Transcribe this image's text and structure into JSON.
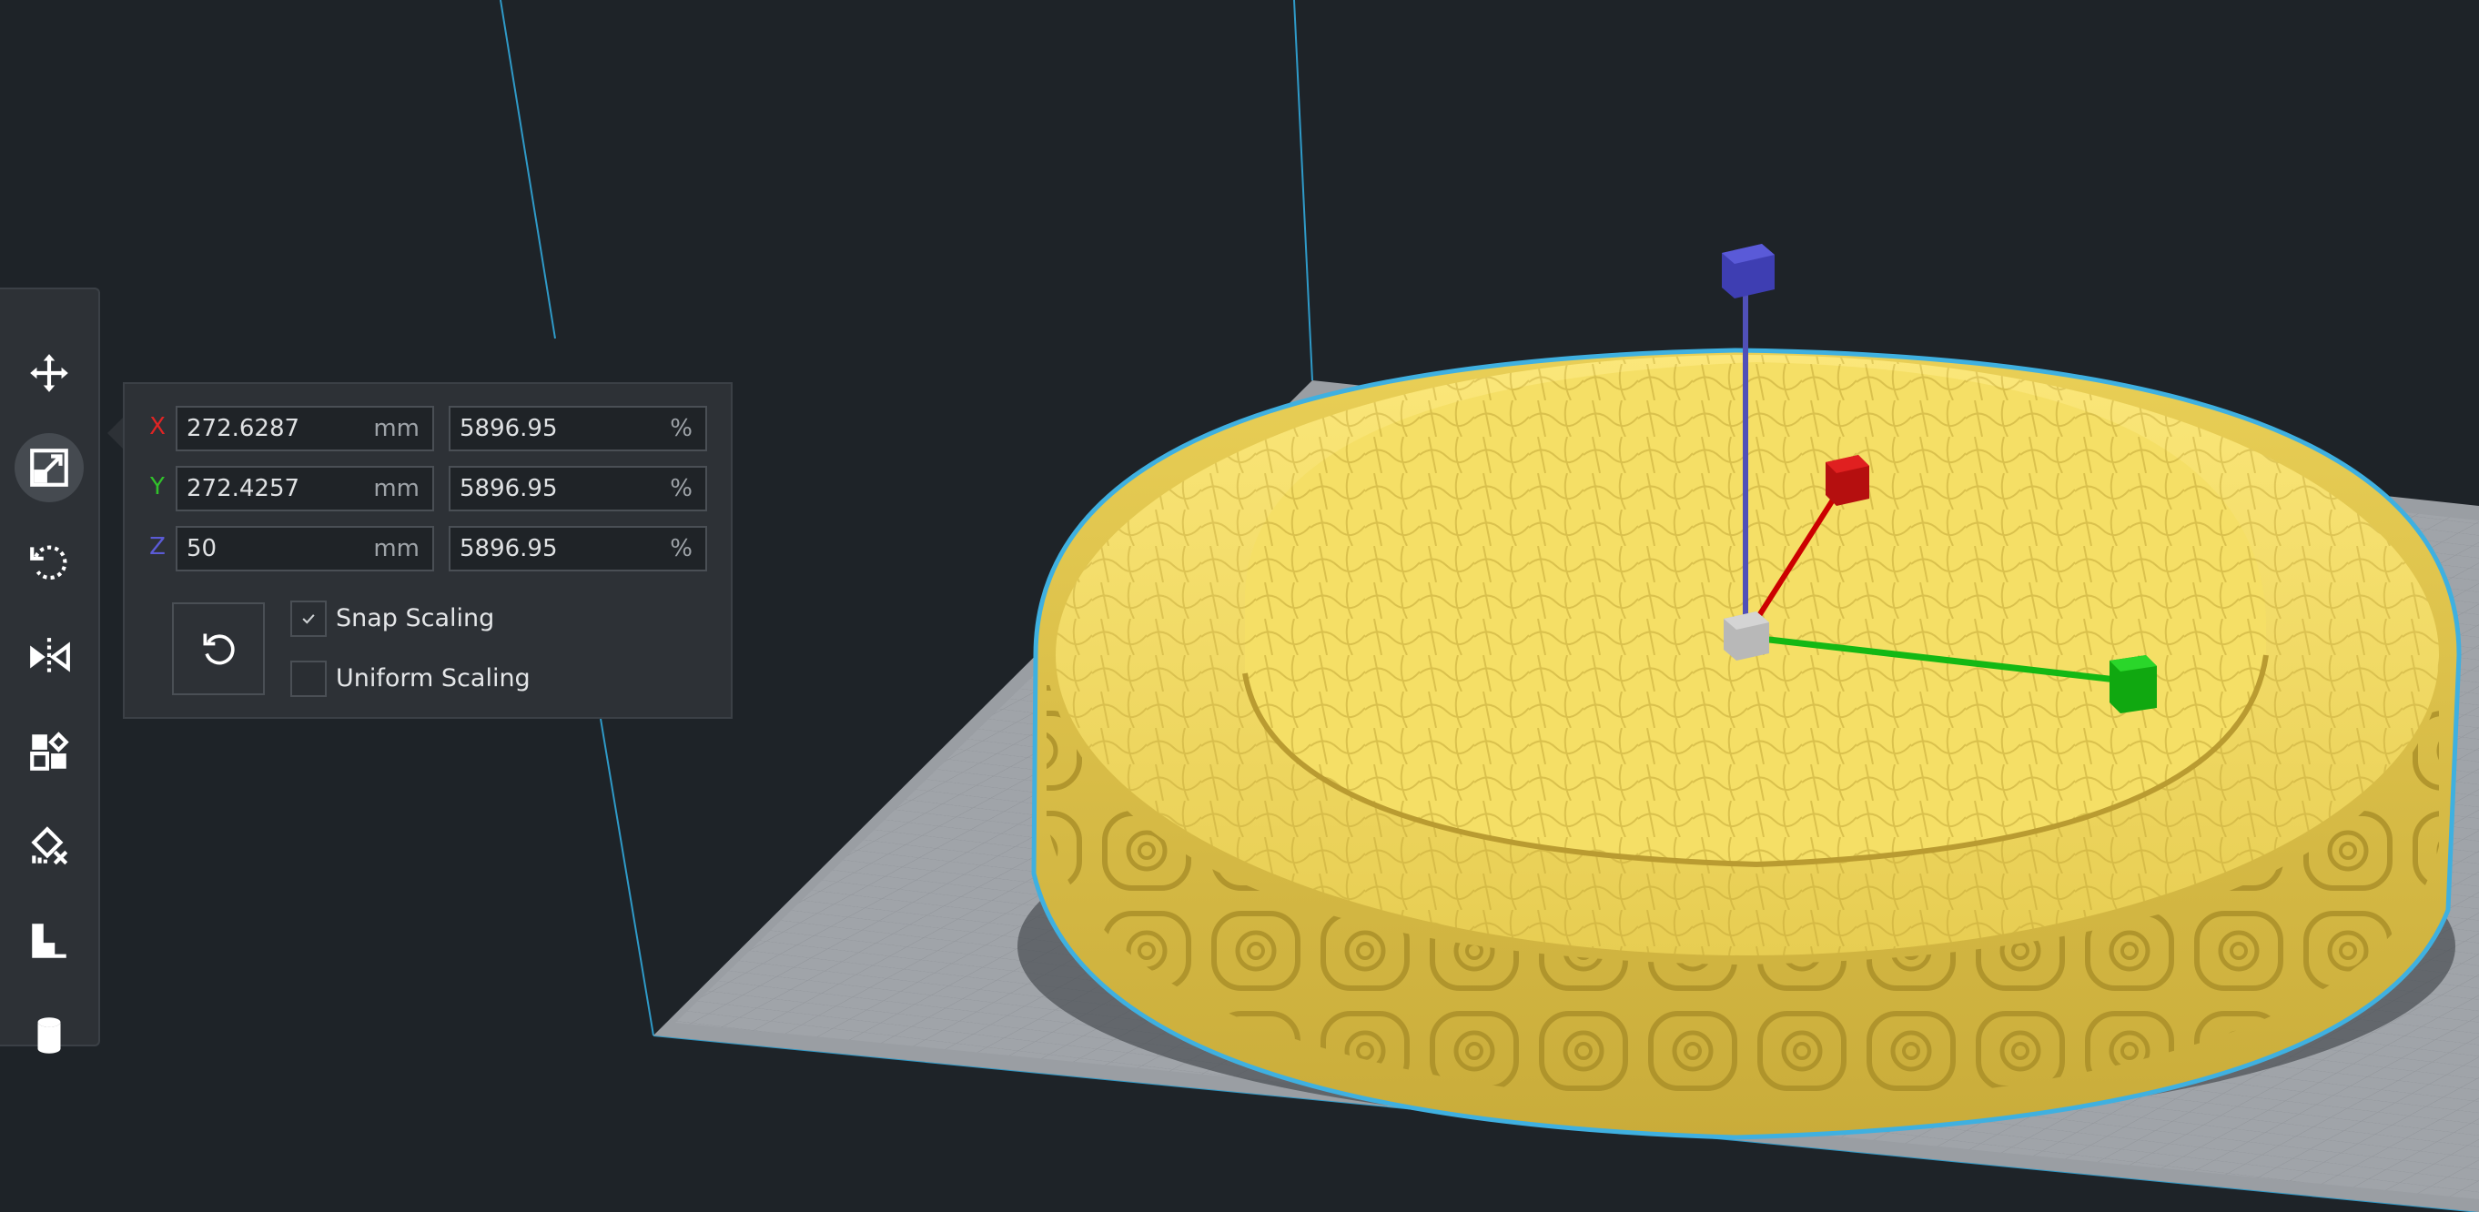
{
  "toolbar": {
    "tools": [
      {
        "name": "move-tool",
        "icon": "move-arrows-icon",
        "active": false
      },
      {
        "name": "scale-tool",
        "icon": "scale-icon",
        "active": true
      },
      {
        "name": "rotate-tool",
        "icon": "rotate-icon",
        "active": false
      },
      {
        "name": "mirror-tool",
        "icon": "mirror-icon",
        "active": false
      },
      {
        "name": "per-model-settings-tool",
        "icon": "per-model-settings-icon",
        "active": false
      },
      {
        "name": "support-blocker-tool",
        "icon": "support-blocker-icon",
        "active": false
      },
      {
        "name": "layer-view-tool",
        "icon": "stairs-icon",
        "active": false
      },
      {
        "name": "cylinder-tool",
        "icon": "cylinder-icon",
        "active": false
      }
    ]
  },
  "scale_panel": {
    "rows": [
      {
        "axis": "X",
        "color": "#e02424",
        "mm": "272.6287",
        "mm_unit": "mm",
        "percent": "5896.95",
        "percent_unit": "%"
      },
      {
        "axis": "Y",
        "color": "#31c12b",
        "mm": "272.4257",
        "mm_unit": "mm",
        "percent": "5896.95",
        "percent_unit": "%"
      },
      {
        "axis": "Z",
        "color": "#5b5bd6",
        "mm": "50",
        "mm_unit": "mm",
        "percent": "5896.95",
        "percent_unit": "%"
      }
    ],
    "snap_scaling": {
      "label": "Snap Scaling",
      "checked": true
    },
    "uniform_scaling": {
      "label": "Uniform Scaling",
      "checked": false
    }
  },
  "colors": {
    "background": "#1e2328",
    "model": "#f2dc60",
    "outline": "#3fb0e0",
    "gizmo_x": "#d00d0d",
    "gizmo_y": "#1cc01c",
    "gizmo_z": "#4040c8"
  }
}
